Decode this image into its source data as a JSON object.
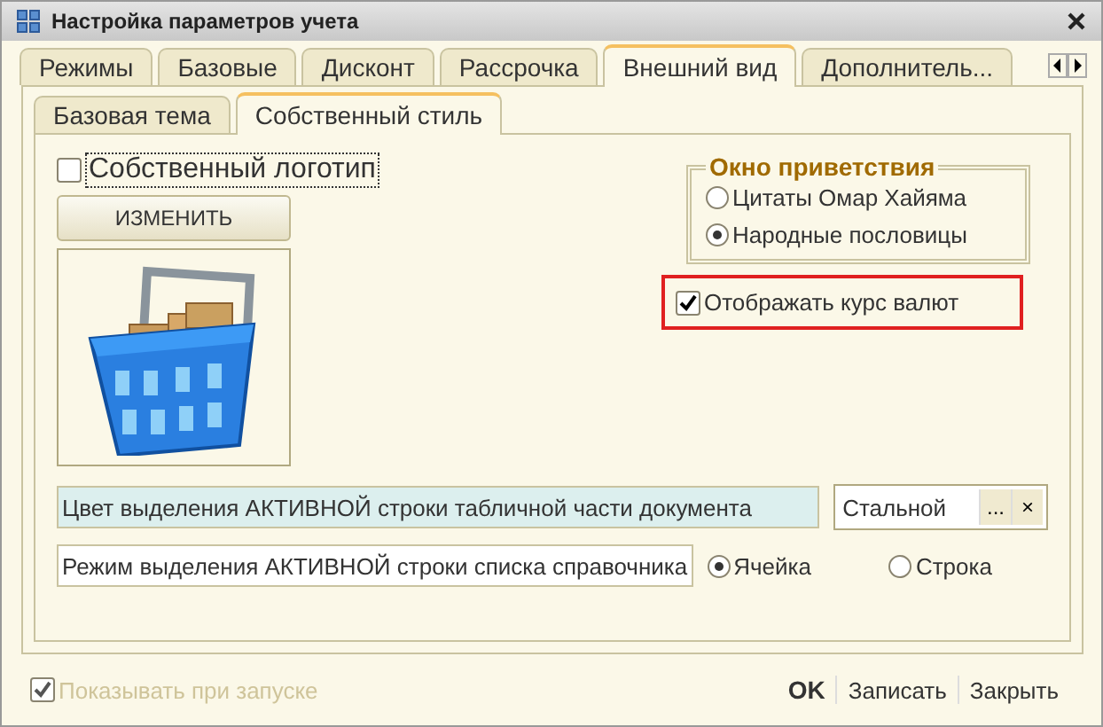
{
  "window": {
    "title": "Настройка параметров учета"
  },
  "tabs": [
    {
      "label": "Режимы",
      "selected": false
    },
    {
      "label": "Базовые",
      "selected": false
    },
    {
      "label": "Дисконт",
      "selected": false
    },
    {
      "label": "Рассрочка",
      "selected": false
    },
    {
      "label": "Внешний вид",
      "selected": true
    },
    {
      "label": "Дополнитель...",
      "selected": false
    }
  ],
  "subtabs": [
    {
      "label": "Базовая тема",
      "selected": false
    },
    {
      "label": "Собственный стиль",
      "selected": true
    }
  ],
  "logo": {
    "label": "Собственный логотип",
    "checked": false,
    "button": "ИЗМЕНИТЬ"
  },
  "greeting": {
    "title": "Окно приветствия",
    "options": [
      {
        "label": "Цитаты Омар Хайяма",
        "selected": false
      },
      {
        "label": "Народные пословицы",
        "selected": true
      }
    ]
  },
  "currency": {
    "label": "Отображать курс валют",
    "checked": true,
    "highlighted": true
  },
  "color_row": {
    "label": "Цвет выделения АКТИВНОЙ строки табличной части документа",
    "value": "Стальной",
    "select": "...",
    "clear": "×"
  },
  "mode_row": {
    "label": "Режим выделения АКТИВНОЙ строки списка справочника",
    "options": [
      {
        "label": "Ячейка",
        "selected": true
      },
      {
        "label": "Строка",
        "selected": false
      }
    ]
  },
  "footer": {
    "show_on_start": {
      "label": "Показывать при запуске",
      "checked": true,
      "disabled": true
    },
    "buttons": [
      {
        "label": "OK",
        "kind": "default"
      },
      {
        "label": "Записать",
        "kind": "plain"
      },
      {
        "label": "Закрыть",
        "kind": "plain"
      }
    ]
  }
}
